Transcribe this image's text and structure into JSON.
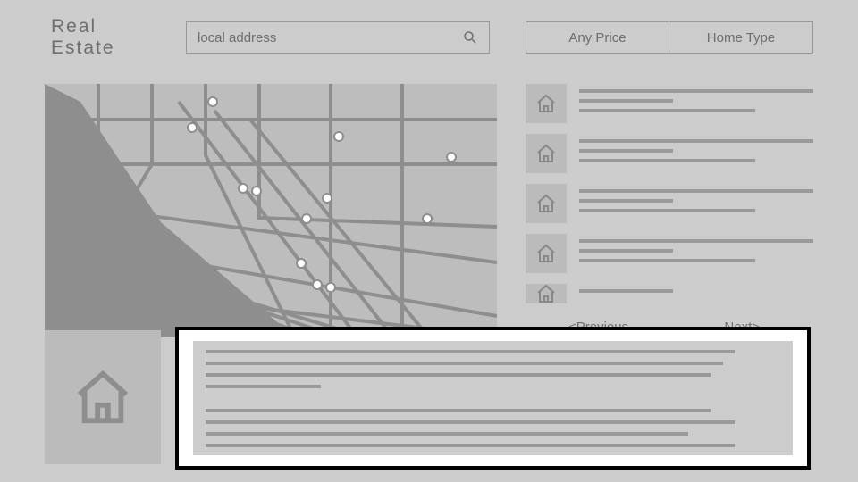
{
  "header": {
    "logo": "Real Estate",
    "search_placeholder": "local address",
    "filters": {
      "price_label": "Any Price",
      "type_label": "Home Type"
    }
  },
  "results": {
    "items": [
      {
        "line1": "",
        "line2": "",
        "line3": ""
      },
      {
        "line1": "",
        "line2": "",
        "line3": ""
      },
      {
        "line1": "",
        "line2": "",
        "line3": ""
      },
      {
        "line1": "",
        "line2": "",
        "line3": ""
      },
      {
        "line1": ""
      }
    ],
    "prev_label": "<Previous",
    "next_label": "Next>"
  },
  "detail": {
    "selected": true
  }
}
